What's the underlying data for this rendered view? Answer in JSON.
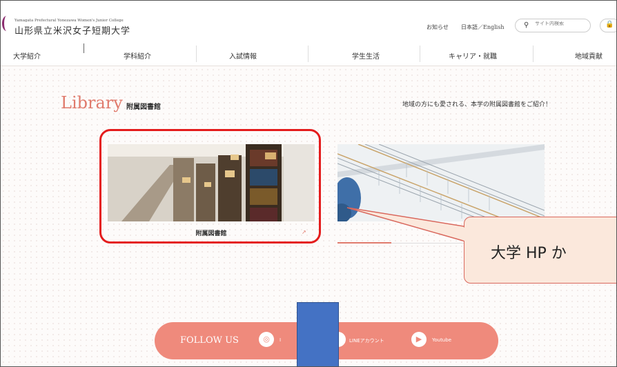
{
  "header": {
    "logo_en": "Yamagata Prefectural Yonezawa Women's Junior College",
    "logo_ja": "山形県立米沢女子短期大学",
    "news_link": "お知らせ",
    "lang_switch": "日本語／English",
    "search_placeholder": "サイト内検索",
    "search_icon": "search-icon",
    "lock_icon": "lock-icon"
  },
  "nav": {
    "items": [
      {
        "label": "大学紹介"
      },
      {
        "label": "学科紹介"
      },
      {
        "label": "入試情報"
      },
      {
        "label": "学生生活"
      },
      {
        "label": "キャリア・就職"
      },
      {
        "label": "地域貢献"
      }
    ]
  },
  "library": {
    "title": "Library",
    "subtitle": "附属図書館",
    "description": "地域の方にも愛される、本学の附属図書館をご紹介！",
    "card1_label": "附属図書館",
    "card1_arrow": "↗"
  },
  "callout": {
    "text": "大学 HP か"
  },
  "follow": {
    "label": "FOLLOW US",
    "instagram_label": "I",
    "line_label": "LINEアカウント",
    "youtube_label": "Youtube"
  },
  "colors": {
    "accent": "#ef8a7c",
    "highlight_border": "#e41c1c",
    "callout_bg": "#fbe8dc",
    "blue_block": "#4472c4"
  }
}
